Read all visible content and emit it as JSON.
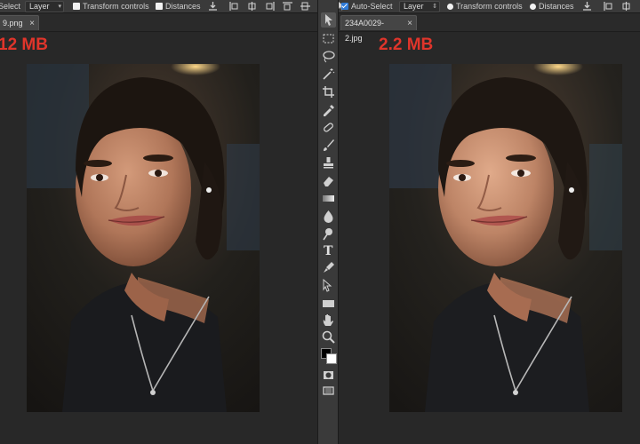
{
  "left_pane": {
    "options": {
      "select_label": "Select",
      "layer_dropdown": "Layer",
      "transform_controls_label": "Transform controls",
      "distances_label": "Distances"
    },
    "tab": {
      "filename": "9.png",
      "close": "×"
    },
    "file_size": "12 MB"
  },
  "right_pane": {
    "options": {
      "auto_select_label": "Auto-Select",
      "layer_dropdown": "Layer",
      "transform_controls_label": "Transform controls",
      "distances_label": "Distances"
    },
    "tab": {
      "filename": "234A0029-2.jpg",
      "close": "×"
    },
    "file_size": "2.2 MB"
  },
  "toolbar": {
    "tools": [
      "move-tool",
      "marquee-tool",
      "lasso-tool",
      "magic-wand-tool",
      "crop-tool",
      "eyedropper-tool",
      "healing-brush-tool",
      "brush-tool",
      "clone-stamp-tool",
      "eraser-tool",
      "gradient-tool",
      "blur-tool",
      "dodge-tool",
      "type-tool",
      "pen-tool",
      "path-selection-tool",
      "rectangle-tool",
      "hand-tool",
      "zoom-tool"
    ],
    "foreground_color": "#000000",
    "background_color": "#ffffff"
  },
  "colors": {
    "file_size_text": "#e0352b",
    "accent": "#2f7bd8"
  }
}
